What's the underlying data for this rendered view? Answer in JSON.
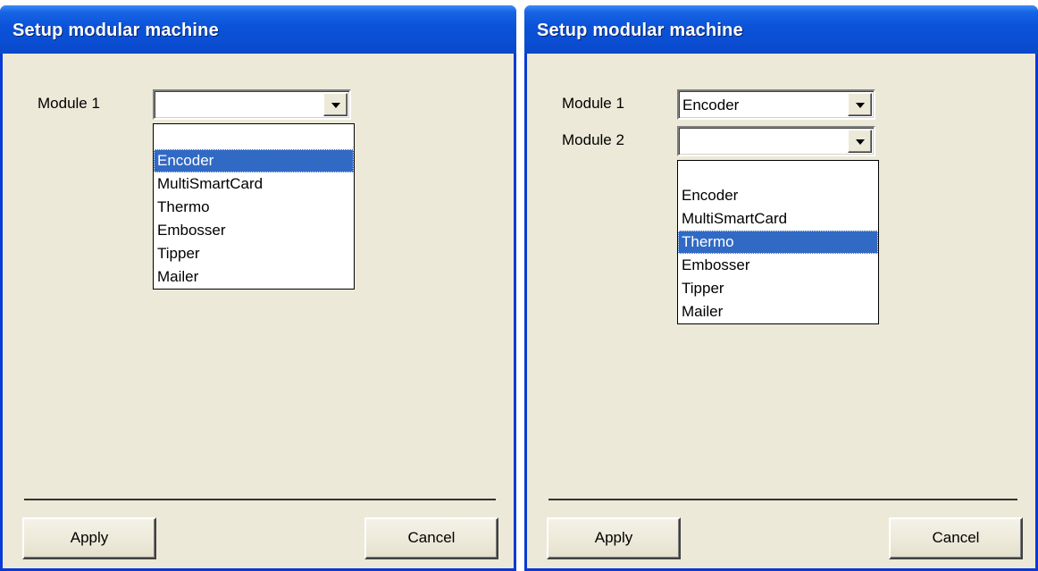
{
  "windows": [
    {
      "title": "Setup modular machine",
      "module1_label": "Module 1",
      "module1_value": "",
      "dropdown_items": [
        "",
        "Encoder",
        "MultiSmartCard",
        "Thermo",
        "Embosser",
        "Tipper",
        "Mailer"
      ],
      "dropdown_selected": "Encoder",
      "apply_label": "Apply",
      "cancel_label": "Cancel"
    },
    {
      "title": "Setup modular machine",
      "module1_label": "Module 1",
      "module1_value": "Encoder",
      "module2_label": "Module 2",
      "module2_value": "",
      "dropdown_items": [
        "Encoder",
        "MultiSmartCard",
        "Thermo",
        "Embosser",
        "Tipper",
        "Mailer"
      ],
      "dropdown_selected": "Thermo",
      "apply_label": "Apply",
      "cancel_label": "Cancel"
    }
  ],
  "colors": {
    "titlebar": "#0a52d8",
    "dialog_bg": "#ece9d8",
    "selection": "#316ac5"
  }
}
